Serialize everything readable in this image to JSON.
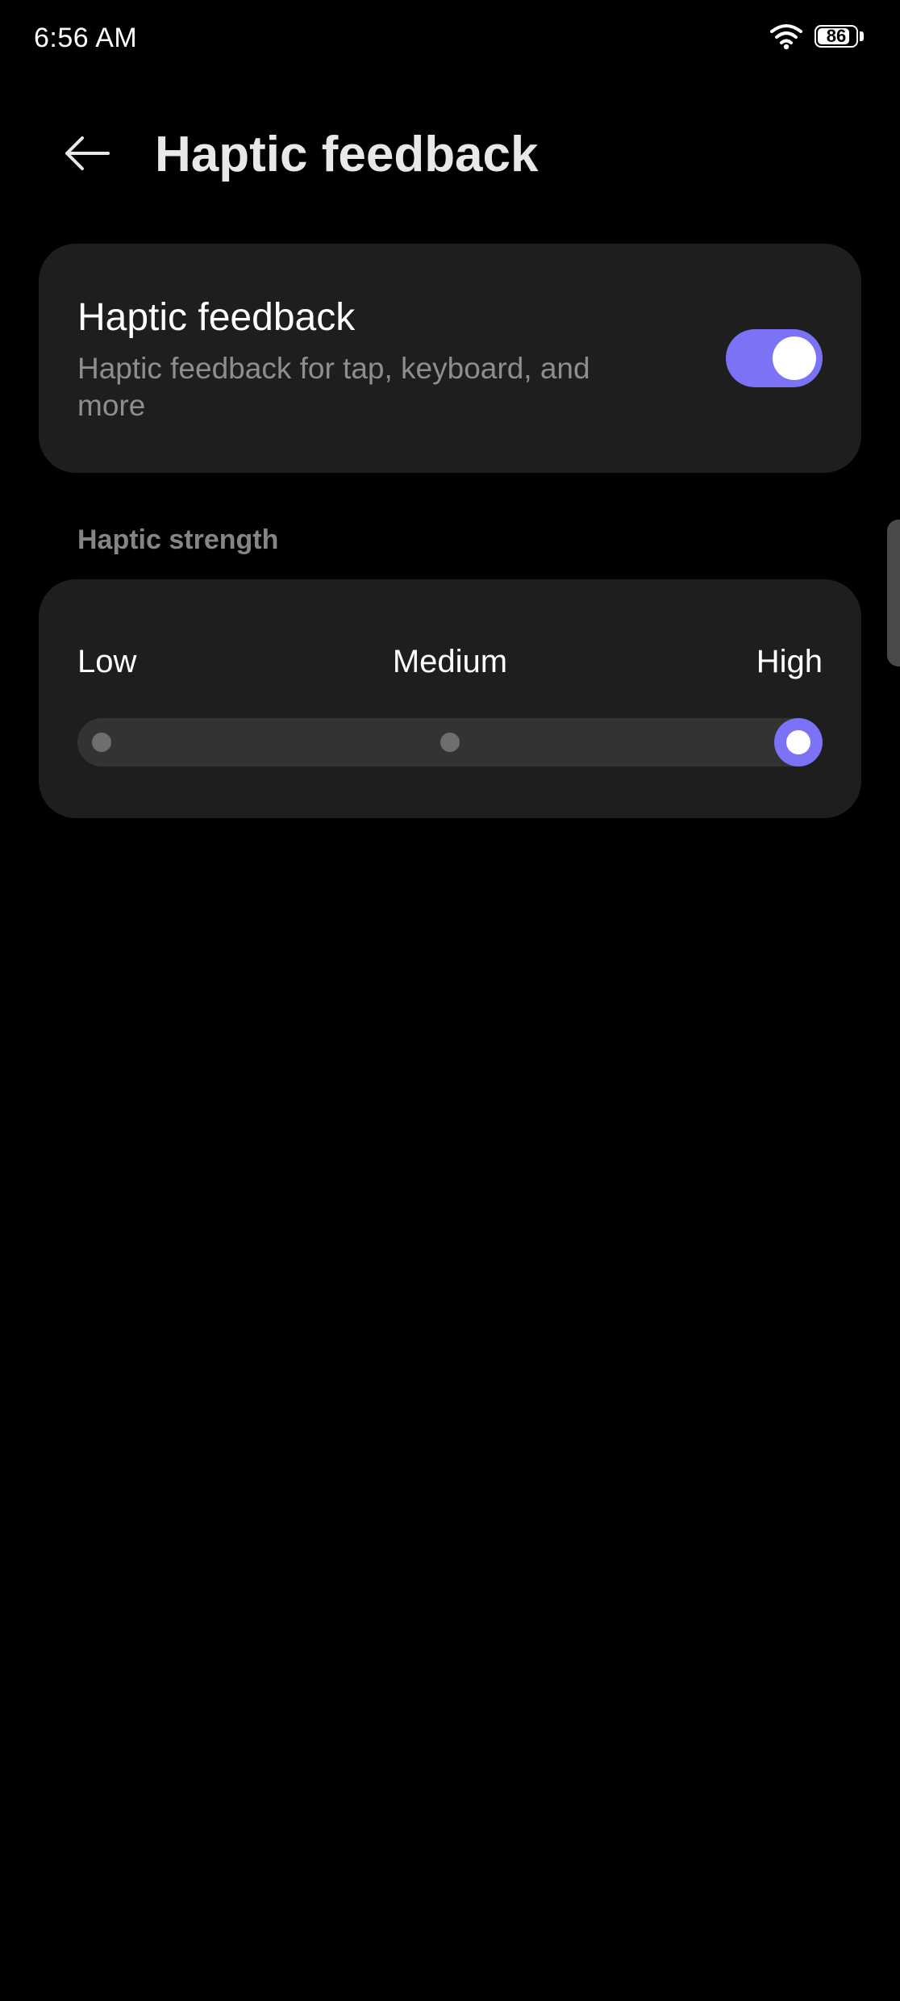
{
  "status_bar": {
    "time": "6:56 AM",
    "battery": 86,
    "battery_text": "86",
    "icons": [
      "wifi-icon",
      "battery-icon"
    ]
  },
  "header": {
    "title": "Haptic feedback",
    "back_icon": "arrow-left-icon"
  },
  "haptic_toggle": {
    "title": "Haptic feedback",
    "subtitle": "Haptic feedback for tap, keyboard, and more",
    "enabled": true
  },
  "strength": {
    "section_label": "Haptic strength",
    "levels": [
      "Low",
      "Medium",
      "High"
    ],
    "selected_index": 2
  },
  "colors": {
    "accent": "#7b72f6",
    "background": "#000000",
    "card": "#1e1e1e",
    "secondary_text": "#8e8e8e"
  }
}
